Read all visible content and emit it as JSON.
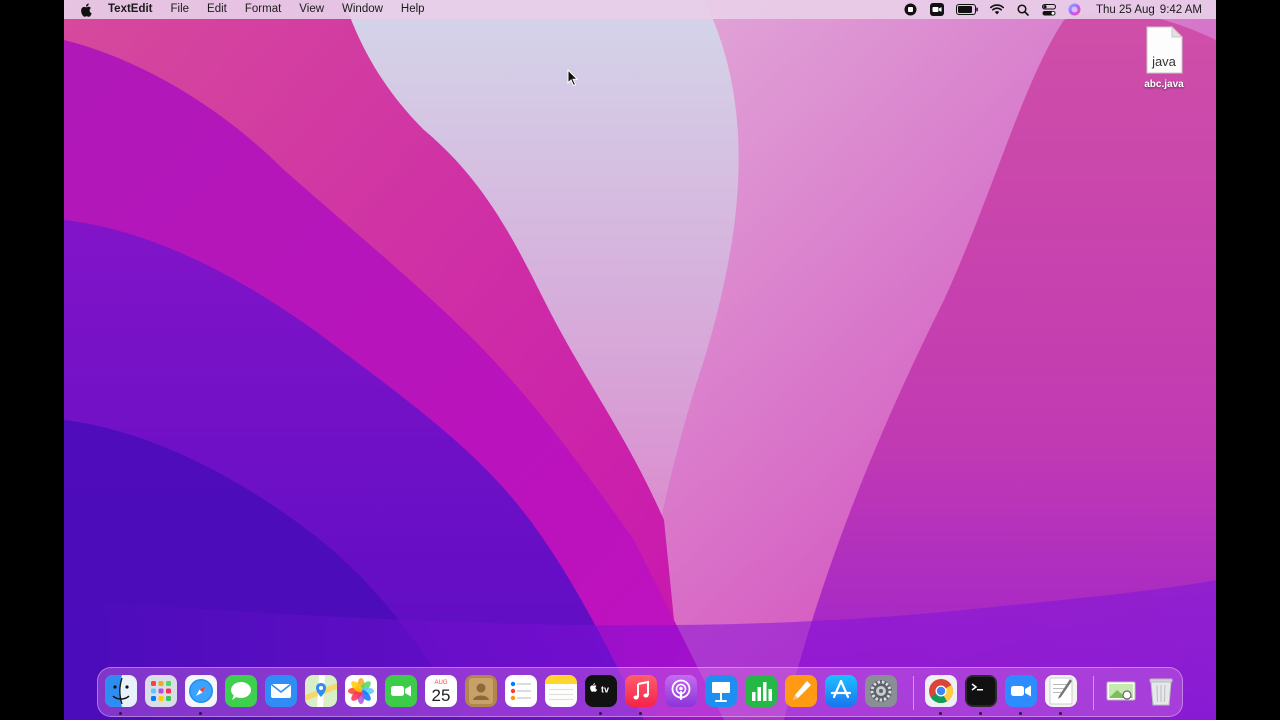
{
  "menubar": {
    "app_name": "TextEdit",
    "menus": [
      "File",
      "Edit",
      "Format",
      "View",
      "Window",
      "Help"
    ],
    "status_icons": [
      "screen-record-icon",
      "facetime-camera-icon",
      "battery-icon",
      "wifi-icon",
      "spotlight-search-icon",
      "control-center-icon",
      "siri-icon"
    ],
    "date": "Thu 25 Aug",
    "time": "9:42 AM"
  },
  "desktop": {
    "file": {
      "name": "abc.java",
      "icon_label": "java"
    }
  },
  "dock": {
    "apps": [
      {
        "name": "Finder",
        "icon": "finder-icon",
        "running": true
      },
      {
        "name": "Launchpad",
        "icon": "launchpad-icon",
        "running": false
      },
      {
        "name": "Safari",
        "icon": "safari-icon",
        "running": true
      },
      {
        "name": "Messages",
        "icon": "messages-icon",
        "running": false
      },
      {
        "name": "Mail",
        "icon": "mail-icon",
        "running": false
      },
      {
        "name": "Maps",
        "icon": "maps-icon",
        "running": false
      },
      {
        "name": "Photos",
        "icon": "photos-icon",
        "running": false
      },
      {
        "name": "FaceTime",
        "icon": "facetime-icon",
        "running": false
      },
      {
        "name": "Calendar",
        "icon": "calendar-icon",
        "running": false,
        "month": "AUG",
        "day": "25"
      },
      {
        "name": "Contacts",
        "icon": "contacts-icon",
        "running": false
      },
      {
        "name": "Reminders",
        "icon": "reminders-icon",
        "running": false
      },
      {
        "name": "Notes",
        "icon": "notes-icon",
        "running": false
      },
      {
        "name": "TV",
        "icon": "apple-tv-icon",
        "running": true,
        "label": "tv"
      },
      {
        "name": "Music",
        "icon": "music-icon",
        "running": true
      },
      {
        "name": "Podcasts",
        "icon": "podcasts-icon",
        "running": false
      },
      {
        "name": "Keynote",
        "icon": "keynote-icon",
        "running": false
      },
      {
        "name": "Numbers",
        "icon": "numbers-icon",
        "running": false
      },
      {
        "name": "Pages",
        "icon": "pages-icon",
        "running": false
      },
      {
        "name": "App Store",
        "icon": "app-store-icon",
        "running": false
      },
      {
        "name": "System Preferences",
        "icon": "system-preferences-icon",
        "running": false
      },
      {
        "name": "Google Chrome",
        "icon": "chrome-icon",
        "running": true
      },
      {
        "name": "Terminal",
        "icon": "terminal-icon",
        "running": true
      },
      {
        "name": "Zoom",
        "icon": "zoom-icon",
        "running": true
      },
      {
        "name": "TextEdit",
        "icon": "textedit-icon",
        "running": true
      },
      {
        "name": "Preview",
        "icon": "preview-icon",
        "running": false
      },
      {
        "name": "Trash",
        "icon": "trash-icon",
        "running": false
      }
    ]
  },
  "colors": {
    "menubar_bg": "#e8cee8",
    "wallpaper_dark": "#4a10b8",
    "wallpaper_magenta": "#c218b8",
    "wallpaper_light": "#d8c8e6"
  }
}
